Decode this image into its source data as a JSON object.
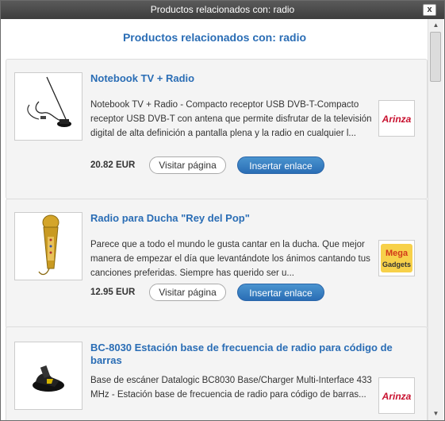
{
  "window": {
    "title": "Productos relacionados con: radio",
    "close_label": "x"
  },
  "heading": "Productos relacionados con: radio",
  "buttons": {
    "visit": "Visitar página",
    "insert": "Insertar enlace"
  },
  "products": [
    {
      "title": "Notebook TV + Radio",
      "description": "Notebook TV + Radio - Compacto receptor USB DVB-T-Compacto receptor USB DVB-T con antena que permite disfrutar de la televisión digital de alta definición a pantalla plena y la radio en cualquier l...",
      "price": "20.82 EUR",
      "brand_logo": "Arinza",
      "image_icon": "usb-dvb-t-antenna-icon"
    },
    {
      "title": "Radio para Ducha \"Rey del Pop\"",
      "description": "Parece que a todo el mundo le gusta cantar en la ducha. Que mejor manera de empezar el día que levantándote los ánimos cantando tus canciones preferidas. Siempre has querido ser u...",
      "price": "12.95 EUR",
      "brand_logo": "Mega Gadgets",
      "image_icon": "gold-microphone-icon"
    },
    {
      "title": "BC-8030 Estación base de frecuencia de radio para código de barras",
      "description": "Base de escáner Datalogic BC8030 Base/Charger Multi-Interface 433 MHz - Estación base de frecuencia de radio para código de barras...",
      "price": "",
      "brand_logo": "Arinza",
      "image_icon": "barcode-scanner-base-icon"
    }
  ],
  "colors": {
    "accent": "#2a6db5",
    "titlebar": "#4a4a4a",
    "card_bg": "#f4f4f4",
    "arinza_red": "#c8102e"
  }
}
